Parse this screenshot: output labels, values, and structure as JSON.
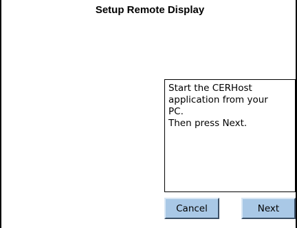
{
  "window": {
    "title": "Setup Remote Display"
  },
  "message": {
    "text": "Start the CERHost\napplication from your\nPC.\nThen press Next."
  },
  "buttons": {
    "cancel_label": "Cancel",
    "next_label": "Next"
  },
  "colors": {
    "background": "#ffffff",
    "button_face": "#a9c8e6",
    "border": "#000000"
  }
}
